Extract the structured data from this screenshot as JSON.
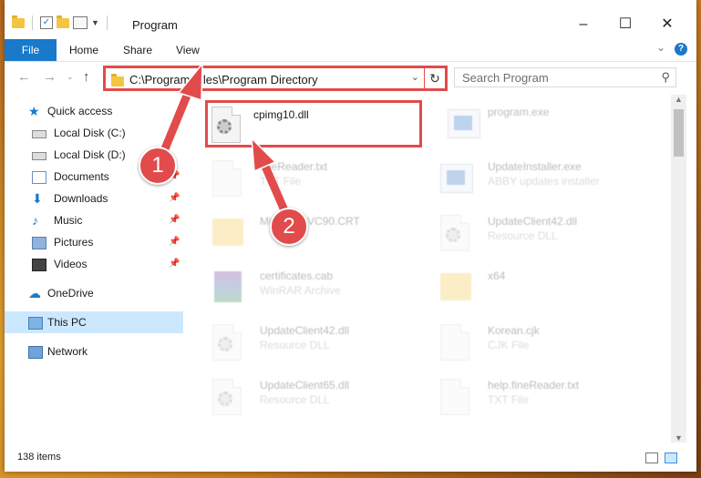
{
  "window": {
    "title": "Program"
  },
  "ribbon": {
    "tabs": [
      "File",
      "Home",
      "Share",
      "View"
    ],
    "help": "?"
  },
  "nav": {
    "address": "C:\\Program Files\\Program Directory",
    "search_placeholder": "Search Program"
  },
  "sidebar": {
    "items": [
      {
        "label": "Quick access",
        "icon": "star-icon"
      },
      {
        "label": "Local Disk (C:)",
        "icon": "drive-icon"
      },
      {
        "label": "Local Disk (D:)",
        "icon": "drive-icon"
      },
      {
        "label": "Documents",
        "icon": "documents-icon"
      },
      {
        "label": "Downloads",
        "icon": "download-icon"
      },
      {
        "label": "Music",
        "icon": "music-icon"
      },
      {
        "label": "Pictures",
        "icon": "pictures-icon"
      },
      {
        "label": "Videos",
        "icon": "videos-icon"
      },
      {
        "label": "OneDrive",
        "icon": "cloud-icon"
      },
      {
        "label": "This PC",
        "icon": "pc-icon"
      },
      {
        "label": "Network",
        "icon": "network-icon"
      }
    ]
  },
  "files": [
    {
      "name": "cpimg10.dll",
      "type": ""
    },
    {
      "name": "program.exe",
      "type": ""
    },
    {
      "name": "fineReader.txt",
      "type": "TXT File"
    },
    {
      "name": "UpdateInstaller.exe",
      "type": "ABBY updates installer"
    },
    {
      "name": "Microsoft.VC90.CRT",
      "type": ""
    },
    {
      "name": "UpdateClient42.dll",
      "type": "Resource DLL"
    },
    {
      "name": "certificates.cab",
      "type": "WinRAR Archive"
    },
    {
      "name": "x64",
      "type": ""
    },
    {
      "name": "UpdateClient42.dll",
      "type": "Resource DLL"
    },
    {
      "name": "Korean.cjk",
      "type": "CJK File"
    },
    {
      "name": "UpdateClient65.dll",
      "type": "Resource DLL"
    },
    {
      "name": "help.fineReader.txt",
      "type": "TXT File"
    }
  ],
  "status": {
    "items": "138 items"
  },
  "annotations": {
    "step1": "1",
    "step2": "2"
  },
  "colors": {
    "accent": "#1979ca",
    "highlight": "#e24b4b",
    "selected": "#cce8ff"
  }
}
